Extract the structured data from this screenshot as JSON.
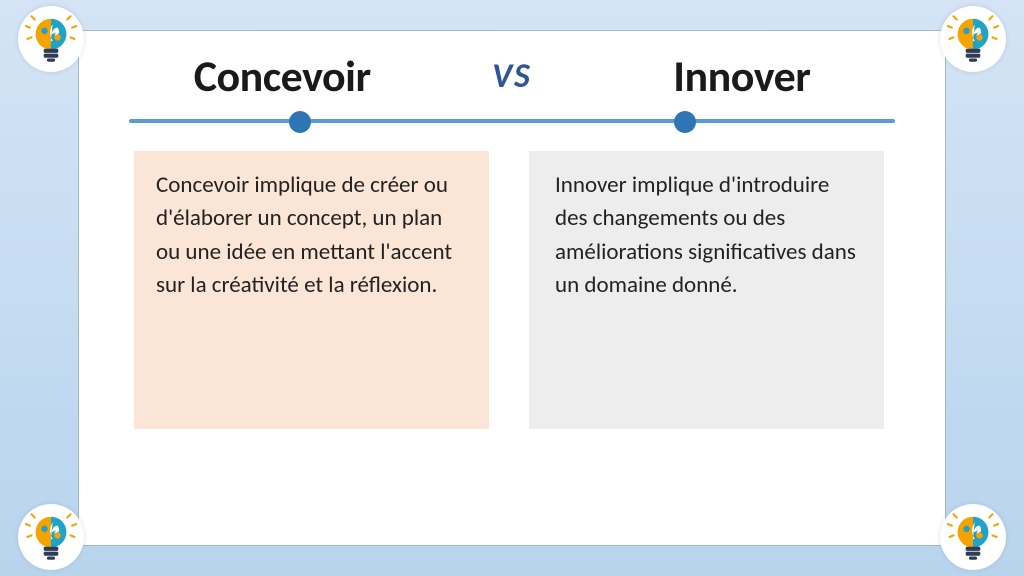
{
  "title_left": "Concevoir",
  "title_right": "Innover",
  "vs_label": "VS",
  "body_left": "Concevoir implique de créer ou d'élaborer un concept, un plan ou une idée en mettant l'accent sur la créativité et la réflexion.",
  "body_right": "Innover implique d'introduire des changements ou des améliorations significatives dans un domaine donné.",
  "colors": {
    "accent_line": "#5b9bd5",
    "accent_node": "#2e75b6",
    "box_left_bg": "#fbe5d6",
    "box_right_bg": "#ededed",
    "vs_color": "#2f5597"
  },
  "icon_name": "lightbulb-idea-icon"
}
